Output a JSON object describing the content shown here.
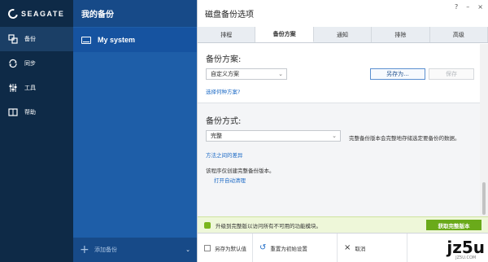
{
  "app": {
    "brand": "SEAGATE"
  },
  "nav": {
    "items": [
      {
        "label": "备份",
        "icon": "backup-icon",
        "active": true
      },
      {
        "label": "同步",
        "icon": "sync-icon",
        "active": false
      },
      {
        "label": "工具",
        "icon": "tools-icon",
        "active": false
      },
      {
        "label": "帮助",
        "icon": "help-icon",
        "active": false
      }
    ]
  },
  "middle": {
    "header": "我的备份",
    "item": "My system",
    "footer_add": "添加备份"
  },
  "dialog": {
    "title": "磁盘备份选项",
    "controls": [
      "?",
      "–",
      "×"
    ],
    "tabs": [
      "排程",
      "备份方案",
      "通知",
      "排除",
      "高级"
    ],
    "active_tab": 1,
    "scheme": {
      "heading": "备份方案:",
      "selected": "自定义方案",
      "save_as": "另存为...",
      "save": "保存",
      "choose_link": "选择何种方案?"
    },
    "method": {
      "heading": "备份方式:",
      "selected": "完整",
      "description": "完整备份版本会完整地存储选定要备份的数据。",
      "diff_link": "方法之间的差异",
      "note": "该程序仅创建完整备份版本。",
      "cleanup_link": "打开自动清理"
    },
    "banner": {
      "text": "升级到完整版以访问所有不可用的功能模块。",
      "cta": "获取完整版本"
    },
    "bottom": {
      "save_default": "另存为默认值",
      "reset": "重置为初始设置",
      "cancel": "取消"
    }
  },
  "watermark": {
    "big": "jz5u",
    "small": "JZ5U.COM"
  },
  "colors": {
    "nav_bg": "#0e2a47",
    "middle_bg": "#1e5ea8",
    "accent": "#1e6bc6",
    "upgrade_green": "#6aaa1a"
  }
}
